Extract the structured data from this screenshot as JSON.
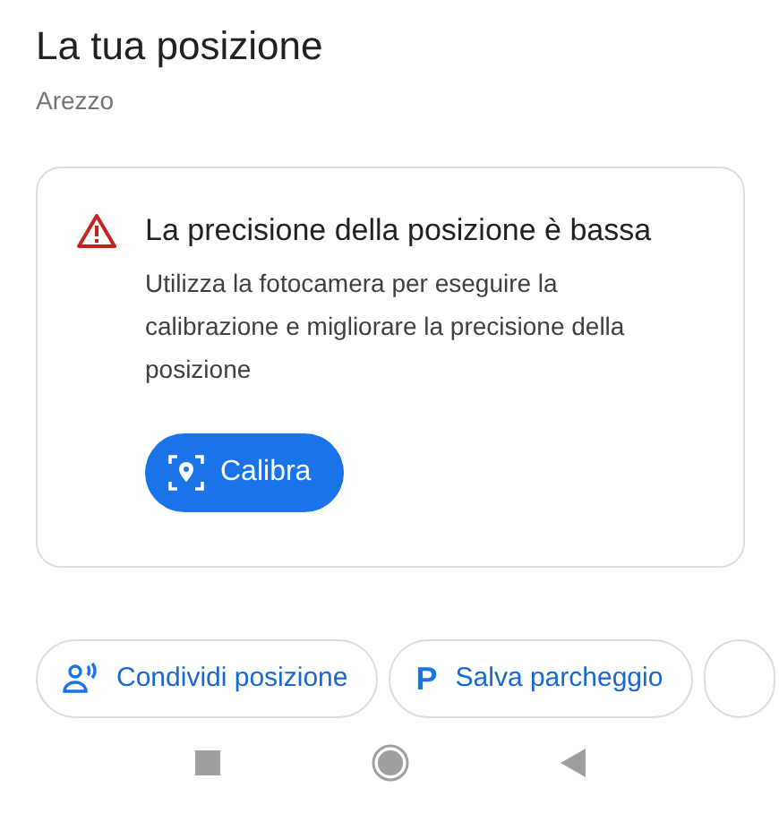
{
  "header": {
    "title": "La tua posizione",
    "subtitle": "Arezzo"
  },
  "alert": {
    "title": "La precisione della posizione è bassa",
    "body": "Utilizza la fotocamera per eseguire la calibrazione e migliorare la precisione della posizione",
    "button": "Calibra"
  },
  "chips": [
    {
      "kind": "share",
      "label": "Condividi posizione"
    },
    {
      "kind": "parking",
      "glyph": "P",
      "label": "Salva parcheggio"
    },
    {
      "kind": "cut"
    }
  ]
}
